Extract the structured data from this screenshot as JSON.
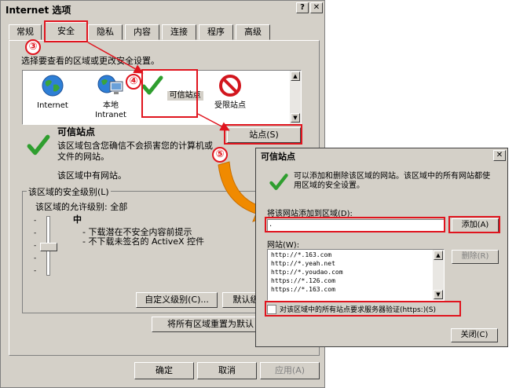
{
  "main_dialog": {
    "title": "Internet 选项",
    "help_btn": "?",
    "close_btn": "✕",
    "tabs": [
      "常规",
      "安全",
      "隐私",
      "内容",
      "连接",
      "程序",
      "高级"
    ],
    "prompt": "选择要查看的区域或更改安全设置。",
    "zones": [
      {
        "label": "Internet",
        "icon": "globe-icon"
      },
      {
        "label": "本地\nIntranet",
        "icon": "intranet-icon"
      },
      {
        "label": "可信站点",
        "icon": "checkmark-icon"
      },
      {
        "label": "受限站点",
        "icon": "no-entry-icon"
      }
    ],
    "zone_title": "可信站点",
    "zone_desc": "该区域包含您确信不会损害您的计算机或\n文件的网站。",
    "zone_has_sites": "该区域中有网站。",
    "sites_button": "站点(S)",
    "security_level_group": "该区域的安全级别(L)",
    "allowed_levels": "该区域的允许级别: 全部",
    "level_name": "中",
    "level_bullets": [
      "- 下载潜在不安全内容前提示",
      "- 不下载未签名的 ActiveX 控件"
    ],
    "custom_level_btn": "自定义级别(C)...",
    "default_level_btn": "默认级",
    "reset_all_btn": "将所有区域重置为默认",
    "ok_btn": "确定",
    "cancel_btn": "取消",
    "apply_btn": "应用(A)"
  },
  "trusted_dialog": {
    "title": "可信站点",
    "close_btn": "✕",
    "info": "可以添加和删除该区域的网站。该区域中的所有网站都使\n用区域的安全设置。",
    "add_label": "将该网站添加到区域(D):",
    "add_input_value": ".",
    "add_btn": "添加(A)",
    "websites_label": "网站(W):",
    "websites": [
      "http://*.163.com",
      "http://*.yeah.net",
      "http://*.youdao.com",
      "https://*.126.com",
      "https://*.163.com"
    ],
    "remove_btn": "删除(R)",
    "require_https_label": "对该区域中的所有站点要求服务器验证(https:)(S)",
    "close_dialog_btn": "关闭(C)"
  },
  "markers": [
    "③",
    "④",
    "⑤"
  ],
  "colors": {
    "highlight": "#e0141e",
    "arrow": "#f08a00",
    "dialog_bg": "#d4d0c8"
  }
}
